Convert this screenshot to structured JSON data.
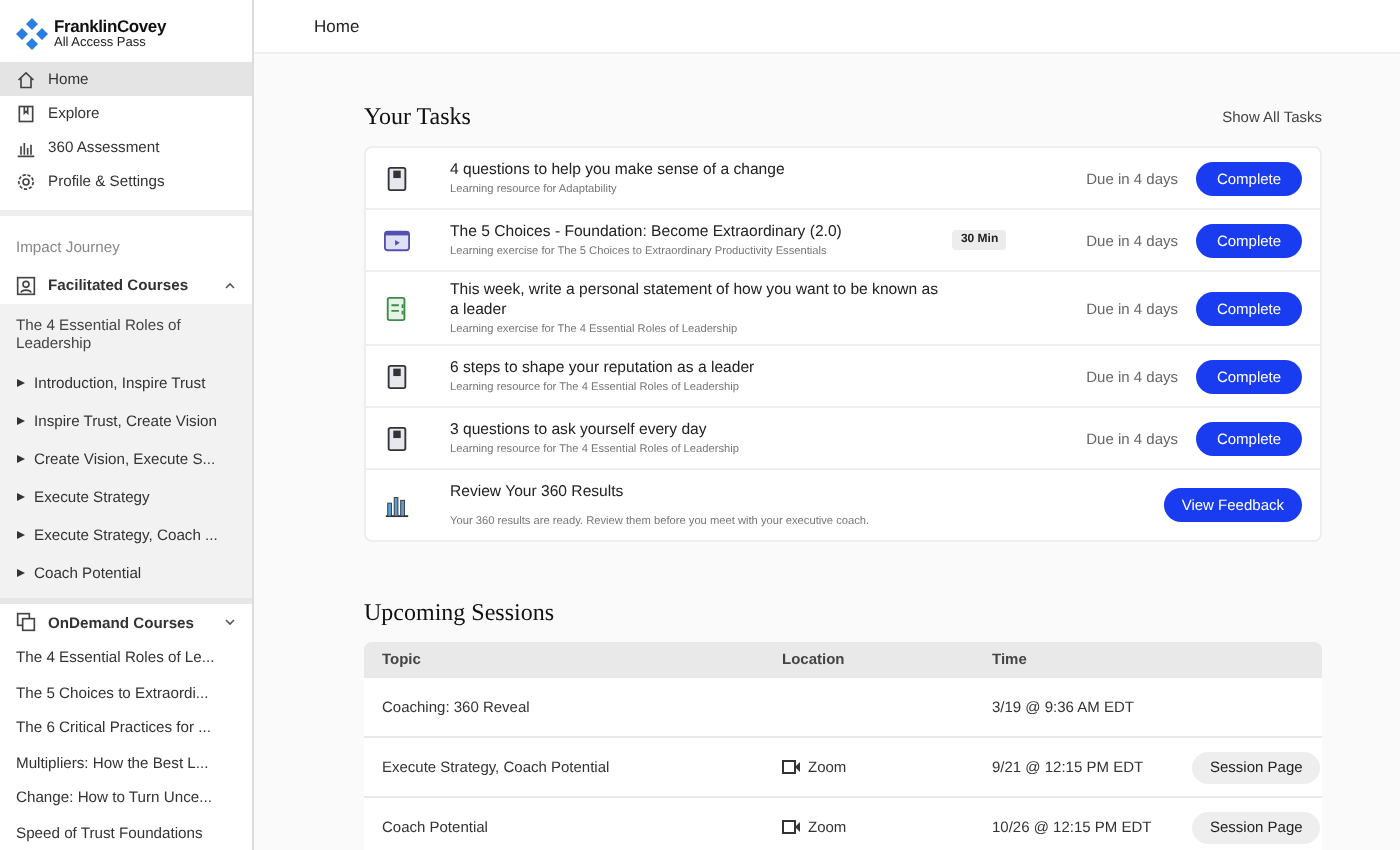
{
  "logo": {
    "brand": "FranklinCovey",
    "product": "All Access Pass"
  },
  "header": {
    "title": "Home"
  },
  "nav": [
    {
      "label": "Home",
      "kind": "home",
      "selected": true
    },
    {
      "label": "Explore",
      "kind": "explore",
      "selected": false
    },
    {
      "label": "360 Assessment",
      "kind": "chart",
      "selected": false
    },
    {
      "label": "Profile & Settings",
      "kind": "gear",
      "selected": false
    }
  ],
  "impact_journey": {
    "label": "Impact Journey"
  },
  "facilitated": {
    "label": "Facilitated Courses",
    "expanded": true,
    "course": "The 4 Essential Roles of Leadership",
    "items": [
      {
        "label": "Introduction, Inspire Trust"
      },
      {
        "label": "Inspire Trust, Create Vision"
      },
      {
        "label": "Create Vision, Execute S..."
      },
      {
        "label": "Execute Strategy"
      },
      {
        "label": "Execute Strategy, Coach ..."
      },
      {
        "label": "Coach Potential"
      }
    ]
  },
  "ondemand": {
    "label": "OnDemand Courses",
    "expanded": false,
    "items": [
      {
        "label": "The 4 Essential Roles of Le..."
      },
      {
        "label": "The 5 Choices to Extraordi..."
      },
      {
        "label": "The 6 Critical Practices for ..."
      },
      {
        "label": "Multipliers: How the Best L..."
      },
      {
        "label": "Change: How to Turn Unce..."
      },
      {
        "label": "Speed of Trust Foundations"
      }
    ]
  },
  "tasks": {
    "title": "Your Tasks",
    "show_all": "Show All Tasks",
    "items": [
      {
        "kind": "resource",
        "title": "4 questions to help you make sense of a change",
        "subtitle": "Learning resource for Adaptability",
        "due": "Due in 4 days",
        "button": "Complete"
      },
      {
        "kind": "video",
        "title": "The 5 Choices - Foundation: Become Extraordinary (2.0)",
        "subtitle": "Learning exercise for The 5 Choices to Extraordinary Productivity Essentials",
        "badge": "30 Min",
        "due": "Due in 4 days",
        "button": "Complete"
      },
      {
        "kind": "exercise",
        "title": "This week, write a personal statement of how you want to be known as a leader",
        "subtitle": "Learning exercise for The 4 Essential Roles of Leadership",
        "due": "Due in 4 days",
        "button": "Complete"
      },
      {
        "kind": "resource",
        "title": "6 steps to shape your reputation as a leader",
        "subtitle": "Learning resource for The 4 Essential Roles of Leadership",
        "due": "Due in 4 days",
        "button": "Complete"
      },
      {
        "kind": "resource",
        "title": "3 questions to ask yourself every day",
        "subtitle": "Learning resource for The 4 Essential Roles of Leadership",
        "due": "Due in 4 days",
        "button": "Complete"
      },
      {
        "kind": "results",
        "title": "Review Your 360 Results",
        "subtitle": "Your 360 results are ready. Review them before you meet with your executive coach.",
        "button": "View Feedback"
      }
    ]
  },
  "sessions": {
    "title": "Upcoming Sessions",
    "columns": [
      "Topic",
      "Location",
      "Time"
    ],
    "rows": [
      {
        "topic": "Coaching: 360 Reveal",
        "time": "3/19 @ 9:36 AM EDT"
      },
      {
        "topic": "Execute Strategy, Coach Potential",
        "location": "Zoom",
        "time": "9/21 @ 12:15 PM EDT",
        "button": "Session Page"
      },
      {
        "topic": "Coach Potential",
        "location": "Zoom",
        "time": "10/26 @ 12:15 PM EDT",
        "button": "Session Page"
      }
    ]
  }
}
